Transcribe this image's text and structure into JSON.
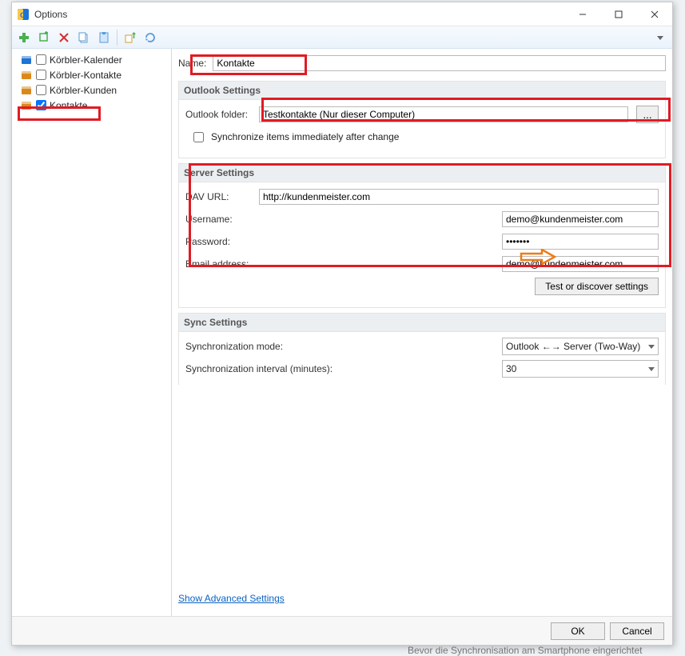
{
  "window": {
    "title": "Options"
  },
  "toolbar": {
    "icons": [
      "add-icon",
      "add-many-icon",
      "delete-icon",
      "copy-icon",
      "paste-icon",
      "export-icon",
      "refresh-icon"
    ]
  },
  "tree": [
    {
      "label": "Körbler-Kalender",
      "checked": false,
      "iconColor": "#1e73d4",
      "iconAlt": "calendar-icon"
    },
    {
      "label": "Körbler-Kontakte",
      "checked": false,
      "iconColor": "#d9891c",
      "iconAlt": "contacts-icon"
    },
    {
      "label": "Körbler-Kunden",
      "checked": false,
      "iconColor": "#d9891c",
      "iconAlt": "contacts-icon"
    },
    {
      "label": "Kontakte",
      "checked": true,
      "iconColor": "#d9891c",
      "iconAlt": "contacts-icon"
    }
  ],
  "nameRow": {
    "label": "Name:",
    "value": "Kontakte"
  },
  "sections": {
    "outlook": {
      "title": "Outlook Settings",
      "folderLabel": "Outlook folder:",
      "folderValue": "Testkontakte (Nur dieser Computer)",
      "browse": "...",
      "syncCheckboxLabel": "Synchronize items immediately after change",
      "syncChecked": false
    },
    "server": {
      "title": "Server Settings",
      "davLabel": "DAV URL:",
      "davValue": "http://kundenmeister.com",
      "userLabel": "Username:",
      "userValue": "demo@kundenmeister.com",
      "pwdLabel": "Password:",
      "pwdValue": "*******",
      "emailLabel": "Email address:",
      "emailValue": "demo@kundenmeister.com",
      "testBtn": "Test or discover settings"
    },
    "sync": {
      "title": "Sync Settings",
      "modeLabel": "Synchronization mode:",
      "modeValue": "Outlook ←→ Server (Two-Way)",
      "intervalLabel": "Synchronization interval (minutes):",
      "intervalValue": "30"
    }
  },
  "advancedLink": "Show Advanced Settings",
  "footer": {
    "ok": "OK",
    "cancel": "Cancel"
  },
  "bgText": "Bevor die Synchronisation am Smartphone eingerichtet"
}
